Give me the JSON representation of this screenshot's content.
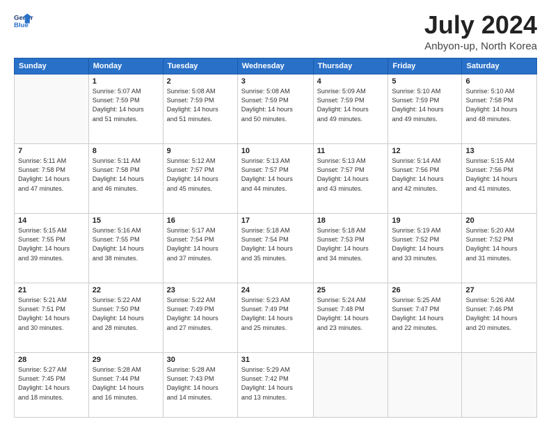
{
  "header": {
    "logo_line1": "General",
    "logo_line2": "Blue",
    "title": "July 2024",
    "subtitle": "Anbyon-up, North Korea"
  },
  "weekdays": [
    "Sunday",
    "Monday",
    "Tuesday",
    "Wednesday",
    "Thursday",
    "Friday",
    "Saturday"
  ],
  "weeks": [
    [
      {
        "day": "",
        "info": ""
      },
      {
        "day": "1",
        "info": "Sunrise: 5:07 AM\nSunset: 7:59 PM\nDaylight: 14 hours\nand 51 minutes."
      },
      {
        "day": "2",
        "info": "Sunrise: 5:08 AM\nSunset: 7:59 PM\nDaylight: 14 hours\nand 51 minutes."
      },
      {
        "day": "3",
        "info": "Sunrise: 5:08 AM\nSunset: 7:59 PM\nDaylight: 14 hours\nand 50 minutes."
      },
      {
        "day": "4",
        "info": "Sunrise: 5:09 AM\nSunset: 7:59 PM\nDaylight: 14 hours\nand 49 minutes."
      },
      {
        "day": "5",
        "info": "Sunrise: 5:10 AM\nSunset: 7:59 PM\nDaylight: 14 hours\nand 49 minutes."
      },
      {
        "day": "6",
        "info": "Sunrise: 5:10 AM\nSunset: 7:58 PM\nDaylight: 14 hours\nand 48 minutes."
      }
    ],
    [
      {
        "day": "7",
        "info": "Sunrise: 5:11 AM\nSunset: 7:58 PM\nDaylight: 14 hours\nand 47 minutes."
      },
      {
        "day": "8",
        "info": "Sunrise: 5:11 AM\nSunset: 7:58 PM\nDaylight: 14 hours\nand 46 minutes."
      },
      {
        "day": "9",
        "info": "Sunrise: 5:12 AM\nSunset: 7:57 PM\nDaylight: 14 hours\nand 45 minutes."
      },
      {
        "day": "10",
        "info": "Sunrise: 5:13 AM\nSunset: 7:57 PM\nDaylight: 14 hours\nand 44 minutes."
      },
      {
        "day": "11",
        "info": "Sunrise: 5:13 AM\nSunset: 7:57 PM\nDaylight: 14 hours\nand 43 minutes."
      },
      {
        "day": "12",
        "info": "Sunrise: 5:14 AM\nSunset: 7:56 PM\nDaylight: 14 hours\nand 42 minutes."
      },
      {
        "day": "13",
        "info": "Sunrise: 5:15 AM\nSunset: 7:56 PM\nDaylight: 14 hours\nand 41 minutes."
      }
    ],
    [
      {
        "day": "14",
        "info": "Sunrise: 5:15 AM\nSunset: 7:55 PM\nDaylight: 14 hours\nand 39 minutes."
      },
      {
        "day": "15",
        "info": "Sunrise: 5:16 AM\nSunset: 7:55 PM\nDaylight: 14 hours\nand 38 minutes."
      },
      {
        "day": "16",
        "info": "Sunrise: 5:17 AM\nSunset: 7:54 PM\nDaylight: 14 hours\nand 37 minutes."
      },
      {
        "day": "17",
        "info": "Sunrise: 5:18 AM\nSunset: 7:54 PM\nDaylight: 14 hours\nand 35 minutes."
      },
      {
        "day": "18",
        "info": "Sunrise: 5:18 AM\nSunset: 7:53 PM\nDaylight: 14 hours\nand 34 minutes."
      },
      {
        "day": "19",
        "info": "Sunrise: 5:19 AM\nSunset: 7:52 PM\nDaylight: 14 hours\nand 33 minutes."
      },
      {
        "day": "20",
        "info": "Sunrise: 5:20 AM\nSunset: 7:52 PM\nDaylight: 14 hours\nand 31 minutes."
      }
    ],
    [
      {
        "day": "21",
        "info": "Sunrise: 5:21 AM\nSunset: 7:51 PM\nDaylight: 14 hours\nand 30 minutes."
      },
      {
        "day": "22",
        "info": "Sunrise: 5:22 AM\nSunset: 7:50 PM\nDaylight: 14 hours\nand 28 minutes."
      },
      {
        "day": "23",
        "info": "Sunrise: 5:22 AM\nSunset: 7:49 PM\nDaylight: 14 hours\nand 27 minutes."
      },
      {
        "day": "24",
        "info": "Sunrise: 5:23 AM\nSunset: 7:49 PM\nDaylight: 14 hours\nand 25 minutes."
      },
      {
        "day": "25",
        "info": "Sunrise: 5:24 AM\nSunset: 7:48 PM\nDaylight: 14 hours\nand 23 minutes."
      },
      {
        "day": "26",
        "info": "Sunrise: 5:25 AM\nSunset: 7:47 PM\nDaylight: 14 hours\nand 22 minutes."
      },
      {
        "day": "27",
        "info": "Sunrise: 5:26 AM\nSunset: 7:46 PM\nDaylight: 14 hours\nand 20 minutes."
      }
    ],
    [
      {
        "day": "28",
        "info": "Sunrise: 5:27 AM\nSunset: 7:45 PM\nDaylight: 14 hours\nand 18 minutes."
      },
      {
        "day": "29",
        "info": "Sunrise: 5:28 AM\nSunset: 7:44 PM\nDaylight: 14 hours\nand 16 minutes."
      },
      {
        "day": "30",
        "info": "Sunrise: 5:28 AM\nSunset: 7:43 PM\nDaylight: 14 hours\nand 14 minutes."
      },
      {
        "day": "31",
        "info": "Sunrise: 5:29 AM\nSunset: 7:42 PM\nDaylight: 14 hours\nand 13 minutes."
      },
      {
        "day": "",
        "info": ""
      },
      {
        "day": "",
        "info": ""
      },
      {
        "day": "",
        "info": ""
      }
    ]
  ]
}
